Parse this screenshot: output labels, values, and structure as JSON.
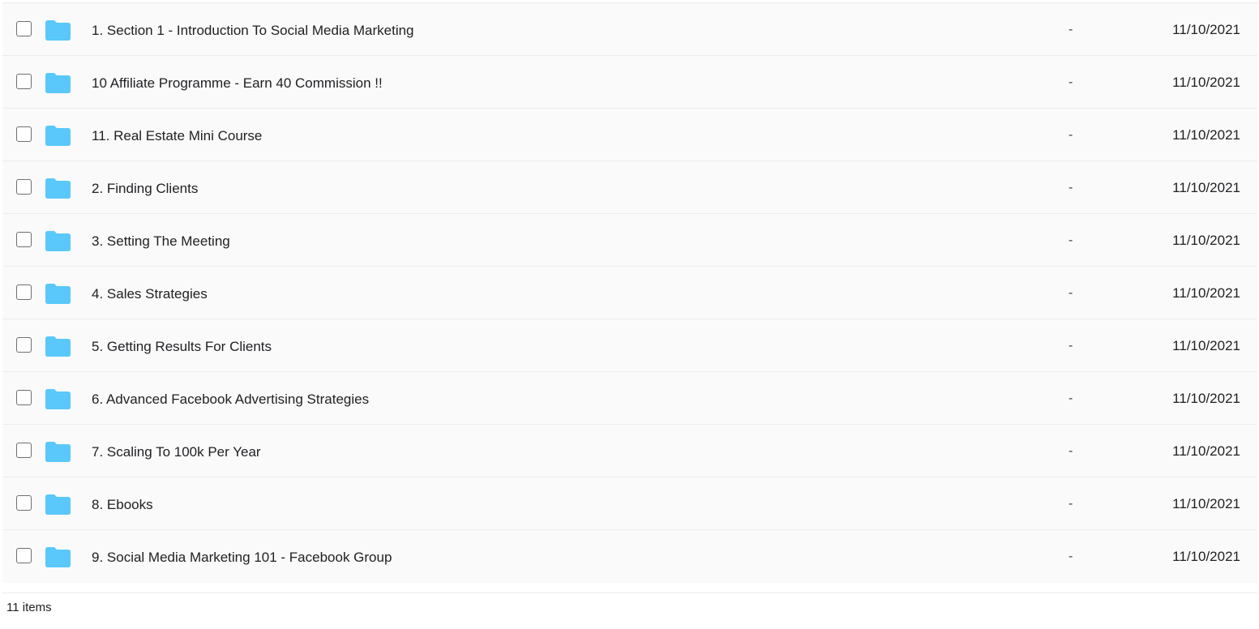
{
  "icons": {
    "folder": "folder-icon",
    "checkbox": "checkbox"
  },
  "colors": {
    "folder": "#5ac8fa",
    "row_background": "#fafafa",
    "divider": "#ededed"
  },
  "files": [
    {
      "name": "1. Section 1 - Introduction To Social Media Marketing",
      "size": "-",
      "date": "11/10/2021"
    },
    {
      "name": "10 Affiliate Programme - Earn 40 Commission !!",
      "size": "-",
      "date": "11/10/2021"
    },
    {
      "name": "11. Real Estate Mini Course",
      "size": "-",
      "date": "11/10/2021"
    },
    {
      "name": "2. Finding Clients",
      "size": "-",
      "date": "11/10/2021"
    },
    {
      "name": "3. Setting The Meeting",
      "size": "-",
      "date": "11/10/2021"
    },
    {
      "name": "4. Sales Strategies",
      "size": "-",
      "date": "11/10/2021"
    },
    {
      "name": "5. Getting Results For Clients",
      "size": "-",
      "date": "11/10/2021"
    },
    {
      "name": "6. Advanced Facebook Advertising Strategies",
      "size": "-",
      "date": "11/10/2021"
    },
    {
      "name": "7. Scaling To 100k Per Year",
      "size": "-",
      "date": "11/10/2021"
    },
    {
      "name": "8. Ebooks",
      "size": "-",
      "date": "11/10/2021"
    },
    {
      "name": "9. Social Media Marketing 101 - Facebook Group",
      "size": "-",
      "date": "11/10/2021"
    }
  ],
  "footer": {
    "item_count": "11 items"
  }
}
